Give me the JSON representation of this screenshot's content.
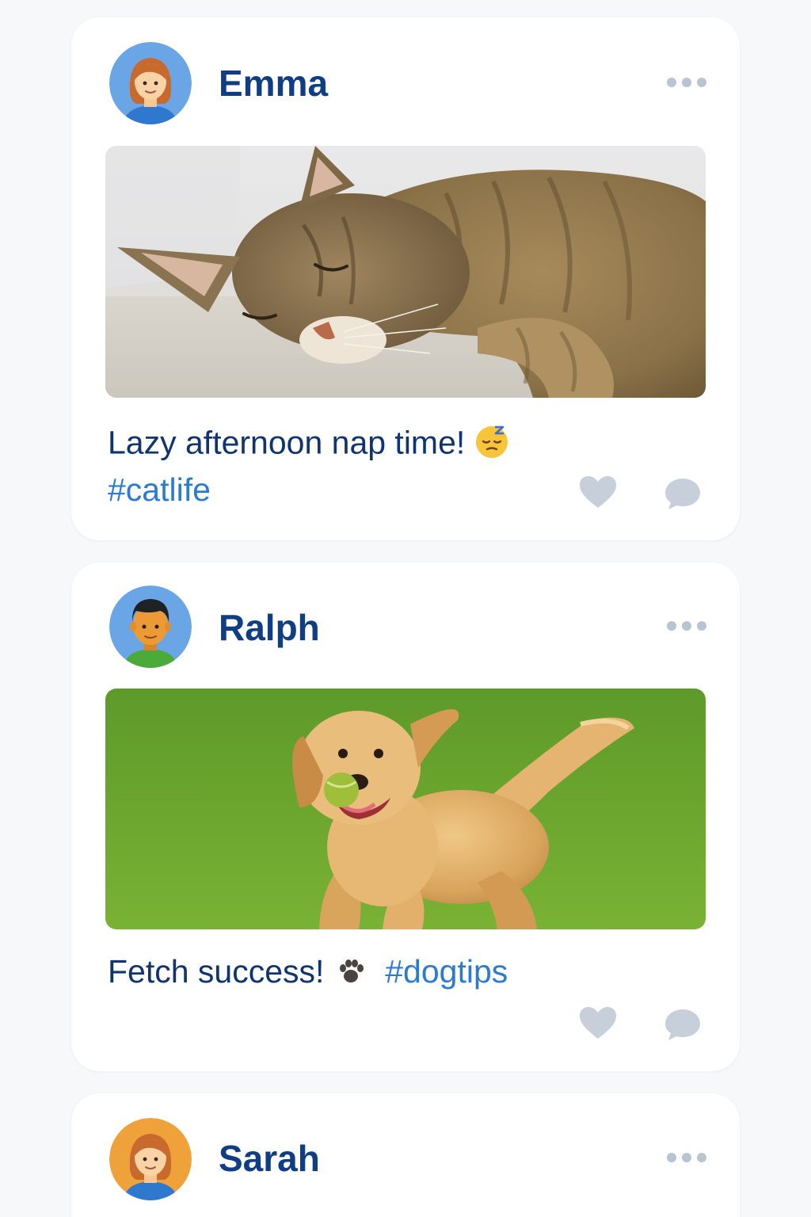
{
  "posts": [
    {
      "username": "Emma",
      "caption": "Lazy afternoon nap time!",
      "hashtag": "#catlife",
      "avatar_icon": "woman-avatar-icon",
      "photo": "sleeping-tabby-cat-photo"
    },
    {
      "username": "Ralph",
      "caption": "Fetch success!",
      "hashtag": "#dogtips",
      "avatar_icon": "man-avatar-icon",
      "photo": "golden-retriever-with-ball-photo"
    },
    {
      "username": "Sarah",
      "avatar_icon": "woman-avatar-icon"
    }
  ],
  "icons": {
    "more": "ellipsis-icon",
    "like": "heart-icon",
    "comment": "speech-bubble-icon",
    "sleepy_emoji": "sleeping-face-emoji",
    "paw_emoji": "paw-prints-emoji"
  },
  "colors": {
    "username": "#103e85",
    "caption": "#0f3470",
    "hashtag": "#2c7bd3",
    "action_icon": "#c7d0da"
  }
}
